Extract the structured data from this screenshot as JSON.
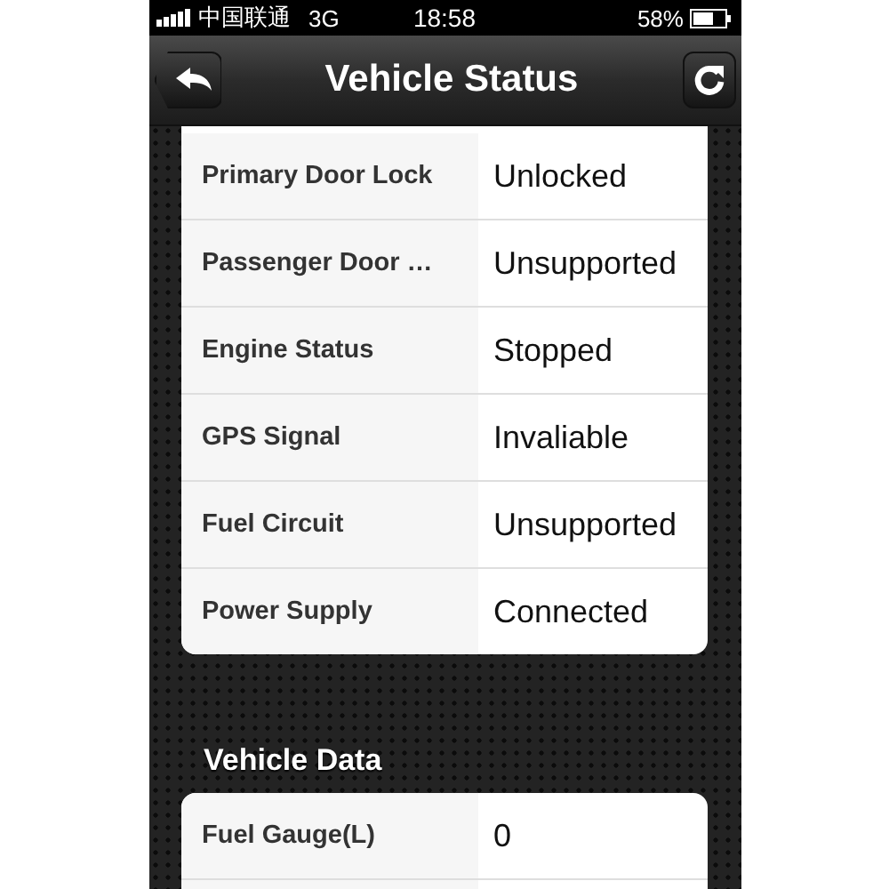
{
  "status_bar": {
    "carrier": "中国联通",
    "network": "3G",
    "time": "18:58",
    "battery": "58%"
  },
  "nav_bar": {
    "title": "Vehicle Status"
  },
  "sections": [
    {
      "rows": [
        {
          "label": "Primary Door Lock",
          "value": "Unlocked"
        },
        {
          "label": "Passenger Door …",
          "value": "Unsupported"
        },
        {
          "label": "Engine Status",
          "value": "Stopped"
        },
        {
          "label": "GPS Signal",
          "value": "Invaliable"
        },
        {
          "label": "Fuel Circuit",
          "value": "Unsupported"
        },
        {
          "label": "Power Supply",
          "value": "Connected"
        }
      ]
    },
    {
      "title": "Vehicle Data",
      "rows": [
        {
          "label": "Fuel Gauge(L)",
          "value": "0"
        }
      ]
    }
  ]
}
